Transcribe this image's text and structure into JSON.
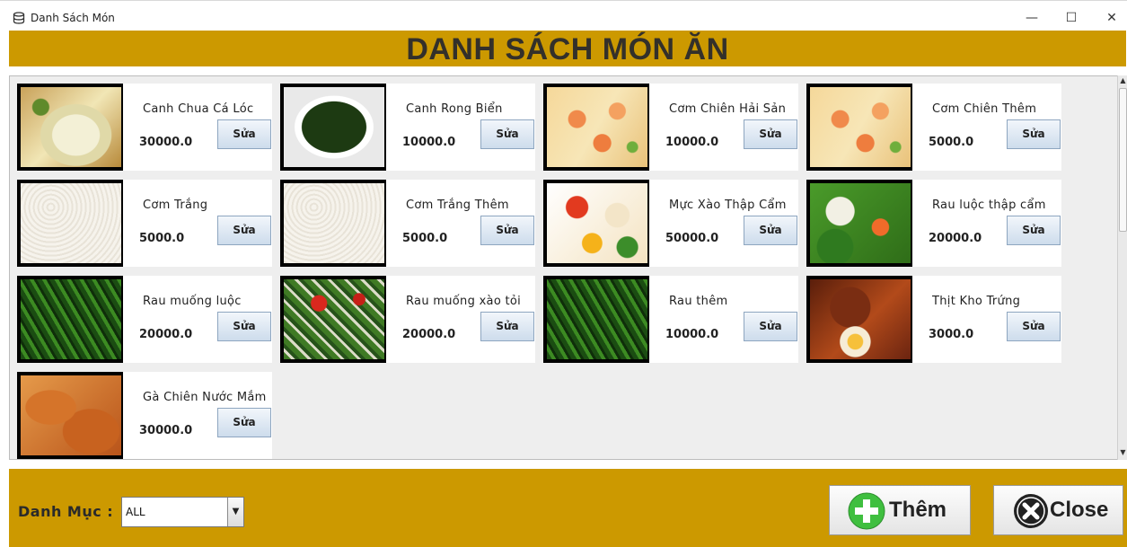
{
  "window": {
    "title": "Danh Sách Món",
    "app_icon": "database-icon",
    "controls": {
      "minimize": "—",
      "maximize": "☐",
      "close": "✕"
    }
  },
  "header": {
    "title": "DANH SÁCH MÓN ĂN",
    "color": "#cc9900"
  },
  "dishes": [
    {
      "name": "Canh Chua Cá Lóc",
      "price": "30000.0",
      "edit_label": "Sửa",
      "image": "canh-chua-photo"
    },
    {
      "name": "Canh Rong Biển",
      "price": "10000.0",
      "edit_label": "Sửa",
      "image": "canh-rong-bien-photo"
    },
    {
      "name": "Cơm Chiên Hải Sản",
      "price": "10000.0",
      "edit_label": "Sửa",
      "image": "com-chien-hai-san-photo"
    },
    {
      "name": "Cơm Chiên Thêm",
      "price": "5000.0",
      "edit_label": "Sửa",
      "image": "com-chien-them-photo"
    },
    {
      "name": "Cơm Trắng",
      "price": "5000.0",
      "edit_label": "Sửa",
      "image": "com-trang-photo"
    },
    {
      "name": "Cơm Trắng Thêm",
      "price": "5000.0",
      "edit_label": "Sửa",
      "image": "com-trang-them-photo"
    },
    {
      "name": "Mực Xào Thập Cẩm",
      "price": "50000.0",
      "edit_label": "Sửa",
      "image": "muc-xao-photo"
    },
    {
      "name": "Rau luộc thập cẩm",
      "price": "20000.0",
      "edit_label": "Sửa",
      "image": "rau-luoc-photo"
    },
    {
      "name": "Rau muống luộc",
      "price": "20000.0",
      "edit_label": "Sửa",
      "image": "rau-muong-luoc-photo"
    },
    {
      "name": "Rau muống xào tỏi",
      "price": "20000.0",
      "edit_label": "Sửa",
      "image": "rau-muong-xao-toi-photo"
    },
    {
      "name": "Rau thêm",
      "price": "10000.0",
      "edit_label": "Sửa",
      "image": "rau-them-photo"
    },
    {
      "name": "Thịt Kho Trứng",
      "price": "3000.0",
      "edit_label": "Sửa",
      "image": "thit-kho-trung-photo"
    },
    {
      "name": "Gà Chiên Nước Mắm",
      "price": "30000.0",
      "edit_label": "Sửa",
      "image": "ga-chien-photo"
    }
  ],
  "footer": {
    "category_label": "Danh Mục :",
    "category_value": "ALL",
    "add_label": "Thêm",
    "close_label": "Close"
  }
}
